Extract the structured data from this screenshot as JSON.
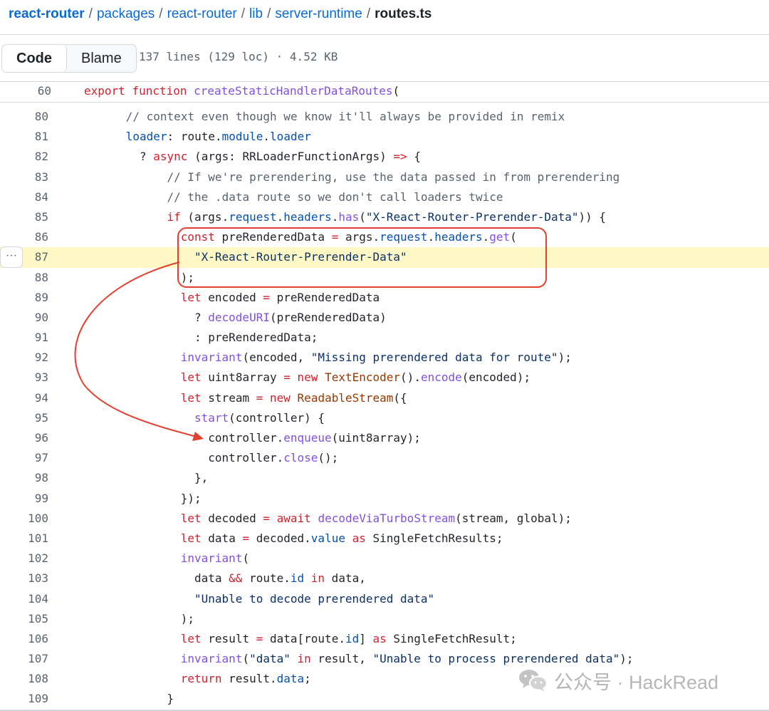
{
  "breadcrumb": {
    "parts": [
      "react-router",
      "packages",
      "react-router",
      "lib",
      "server-runtime"
    ],
    "current": "routes.ts",
    "separator": "/"
  },
  "toolbar": {
    "code_label": "Code",
    "blame_label": "Blame",
    "file_info": "137 lines (129 loc) · 4.52 KB"
  },
  "sticky_header": {
    "line_number": "60",
    "tokens": [
      {
        "t": "export",
        "c": "k"
      },
      {
        "t": " "
      },
      {
        "t": "function",
        "c": "k"
      },
      {
        "t": " "
      },
      {
        "t": "createStaticHandlerDataRoutes",
        "c": "f"
      },
      {
        "t": "("
      }
    ]
  },
  "highlight_line": "87",
  "code_lines": [
    {
      "n": "80",
      "i": 3,
      "tokens": [
        {
          "t": "// context even though we know it'll always be provided in remix",
          "c": "c"
        }
      ]
    },
    {
      "n": "81",
      "i": 3,
      "tokens": [
        {
          "t": "loader",
          "c": "p"
        },
        {
          "t": ": route."
        },
        {
          "t": "module",
          "c": "p"
        },
        {
          "t": "."
        },
        {
          "t": "loader",
          "c": "p"
        }
      ]
    },
    {
      "n": "82",
      "i": 4,
      "tokens": [
        {
          "t": "? "
        },
        {
          "t": "async",
          "c": "k"
        },
        {
          "t": " (args: RRLoaderFunctionArgs) "
        },
        {
          "t": "=>",
          "c": "k"
        },
        {
          "t": " {"
        }
      ]
    },
    {
      "n": "83",
      "i": 6,
      "tokens": [
        {
          "t": "// If we're prerendering, use the data passed in from prerendering",
          "c": "c"
        }
      ]
    },
    {
      "n": "84",
      "i": 6,
      "tokens": [
        {
          "t": "// the .data route so we don't call loaders twice",
          "c": "c"
        }
      ]
    },
    {
      "n": "85",
      "i": 6,
      "tokens": [
        {
          "t": "if",
          "c": "k"
        },
        {
          "t": " (args."
        },
        {
          "t": "request",
          "c": "p"
        },
        {
          "t": "."
        },
        {
          "t": "headers",
          "c": "p"
        },
        {
          "t": "."
        },
        {
          "t": "has",
          "c": "f"
        },
        {
          "t": "("
        },
        {
          "t": "\"X-React-Router-Prerender-Data\"",
          "c": "s"
        },
        {
          "t": ")) {"
        }
      ]
    },
    {
      "n": "86",
      "i": 7,
      "tokens": [
        {
          "t": "const",
          "c": "k"
        },
        {
          "t": " preRenderedData "
        },
        {
          "t": "=",
          "c": "k"
        },
        {
          "t": " args."
        },
        {
          "t": "request",
          "c": "p"
        },
        {
          "t": "."
        },
        {
          "t": "headers",
          "c": "p"
        },
        {
          "t": "."
        },
        {
          "t": "get",
          "c": "f"
        },
        {
          "t": "("
        }
      ]
    },
    {
      "n": "87",
      "i": 8,
      "tokens": [
        {
          "t": "\"X-React-Router-Prerender-Data\"",
          "c": "s"
        }
      ]
    },
    {
      "n": "88",
      "i": 7,
      "tokens": [
        {
          "t": ");"
        }
      ]
    },
    {
      "n": "89",
      "i": 7,
      "tokens": [
        {
          "t": "let",
          "c": "k"
        },
        {
          "t": " encoded "
        },
        {
          "t": "=",
          "c": "k"
        },
        {
          "t": " preRenderedData"
        }
      ]
    },
    {
      "n": "90",
      "i": 8,
      "tokens": [
        {
          "t": "? "
        },
        {
          "t": "decodeURI",
          "c": "f"
        },
        {
          "t": "(preRenderedData)"
        }
      ]
    },
    {
      "n": "91",
      "i": 8,
      "tokens": [
        {
          "t": ": preRenderedData;"
        }
      ]
    },
    {
      "n": "92",
      "i": 7,
      "tokens": [
        {
          "t": "invariant",
          "c": "f"
        },
        {
          "t": "(encoded, "
        },
        {
          "t": "\"Missing prerendered data for route\"",
          "c": "s"
        },
        {
          "t": ");"
        }
      ]
    },
    {
      "n": "93",
      "i": 7,
      "tokens": [
        {
          "t": "let",
          "c": "k"
        },
        {
          "t": " uint8array "
        },
        {
          "t": "=",
          "c": "k"
        },
        {
          "t": " "
        },
        {
          "t": "new",
          "c": "k"
        },
        {
          "t": " "
        },
        {
          "t": "TextEncoder",
          "c": "t"
        },
        {
          "t": "()."
        },
        {
          "t": "encode",
          "c": "f"
        },
        {
          "t": "(encoded);"
        }
      ]
    },
    {
      "n": "94",
      "i": 7,
      "tokens": [
        {
          "t": "let",
          "c": "k"
        },
        {
          "t": " stream "
        },
        {
          "t": "=",
          "c": "k"
        },
        {
          "t": " "
        },
        {
          "t": "new",
          "c": "k"
        },
        {
          "t": " "
        },
        {
          "t": "ReadableStream",
          "c": "t"
        },
        {
          "t": "({"
        }
      ]
    },
    {
      "n": "95",
      "i": 8,
      "tokens": [
        {
          "t": "start",
          "c": "f"
        },
        {
          "t": "(controller) {"
        }
      ]
    },
    {
      "n": "96",
      "i": 9,
      "tokens": [
        {
          "t": "controller."
        },
        {
          "t": "enqueue",
          "c": "f"
        },
        {
          "t": "(uint8array);"
        }
      ]
    },
    {
      "n": "97",
      "i": 9,
      "tokens": [
        {
          "t": "controller."
        },
        {
          "t": "close",
          "c": "f"
        },
        {
          "t": "();"
        }
      ]
    },
    {
      "n": "98",
      "i": 8,
      "tokens": [
        {
          "t": "},"
        }
      ]
    },
    {
      "n": "99",
      "i": 7,
      "tokens": [
        {
          "t": "});"
        }
      ]
    },
    {
      "n": "100",
      "i": 7,
      "tokens": [
        {
          "t": "let",
          "c": "k"
        },
        {
          "t": " decoded "
        },
        {
          "t": "=",
          "c": "k"
        },
        {
          "t": " "
        },
        {
          "t": "await",
          "c": "k"
        },
        {
          "t": " "
        },
        {
          "t": "decodeViaTurboStream",
          "c": "f"
        },
        {
          "t": "(stream, global);"
        }
      ]
    },
    {
      "n": "101",
      "i": 7,
      "tokens": [
        {
          "t": "let",
          "c": "k"
        },
        {
          "t": " data "
        },
        {
          "t": "=",
          "c": "k"
        },
        {
          "t": " decoded."
        },
        {
          "t": "value",
          "c": "p"
        },
        {
          "t": " "
        },
        {
          "t": "as",
          "c": "k"
        },
        {
          "t": " SingleFetchResults;"
        }
      ]
    },
    {
      "n": "102",
      "i": 7,
      "tokens": [
        {
          "t": "invariant",
          "c": "f"
        },
        {
          "t": "("
        }
      ]
    },
    {
      "n": "103",
      "i": 8,
      "tokens": [
        {
          "t": "data "
        },
        {
          "t": "&&",
          "c": "k"
        },
        {
          "t": " route."
        },
        {
          "t": "id",
          "c": "p"
        },
        {
          "t": " "
        },
        {
          "t": "in",
          "c": "k"
        },
        {
          "t": " data,"
        }
      ]
    },
    {
      "n": "104",
      "i": 8,
      "tokens": [
        {
          "t": "\"Unable to decode prerendered data\"",
          "c": "s"
        }
      ]
    },
    {
      "n": "105",
      "i": 7,
      "tokens": [
        {
          "t": ");"
        }
      ]
    },
    {
      "n": "106",
      "i": 7,
      "tokens": [
        {
          "t": "let",
          "c": "k"
        },
        {
          "t": " result "
        },
        {
          "t": "=",
          "c": "k"
        },
        {
          "t": " data[route."
        },
        {
          "t": "id",
          "c": "p"
        },
        {
          "t": "] "
        },
        {
          "t": "as",
          "c": "k"
        },
        {
          "t": " SingleFetchResult;"
        }
      ]
    },
    {
      "n": "107",
      "i": 7,
      "tokens": [
        {
          "t": "invariant",
          "c": "f"
        },
        {
          "t": "("
        },
        {
          "t": "\"data\"",
          "c": "s"
        },
        {
          "t": " "
        },
        {
          "t": "in",
          "c": "k"
        },
        {
          "t": " result, "
        },
        {
          "t": "\"Unable to process prerendered data\"",
          "c": "s"
        },
        {
          "t": ");"
        }
      ]
    },
    {
      "n": "108",
      "i": 7,
      "tokens": [
        {
          "t": "return",
          "c": "k"
        },
        {
          "t": " result."
        },
        {
          "t": "data",
          "c": "p"
        },
        {
          "t": ";"
        }
      ]
    },
    {
      "n": "109",
      "i": 6,
      "tokens": [
        {
          "t": "}"
        }
      ]
    }
  ],
  "annotation_color": "#e5402f",
  "watermark": {
    "text": "公众号 · HackRead"
  }
}
